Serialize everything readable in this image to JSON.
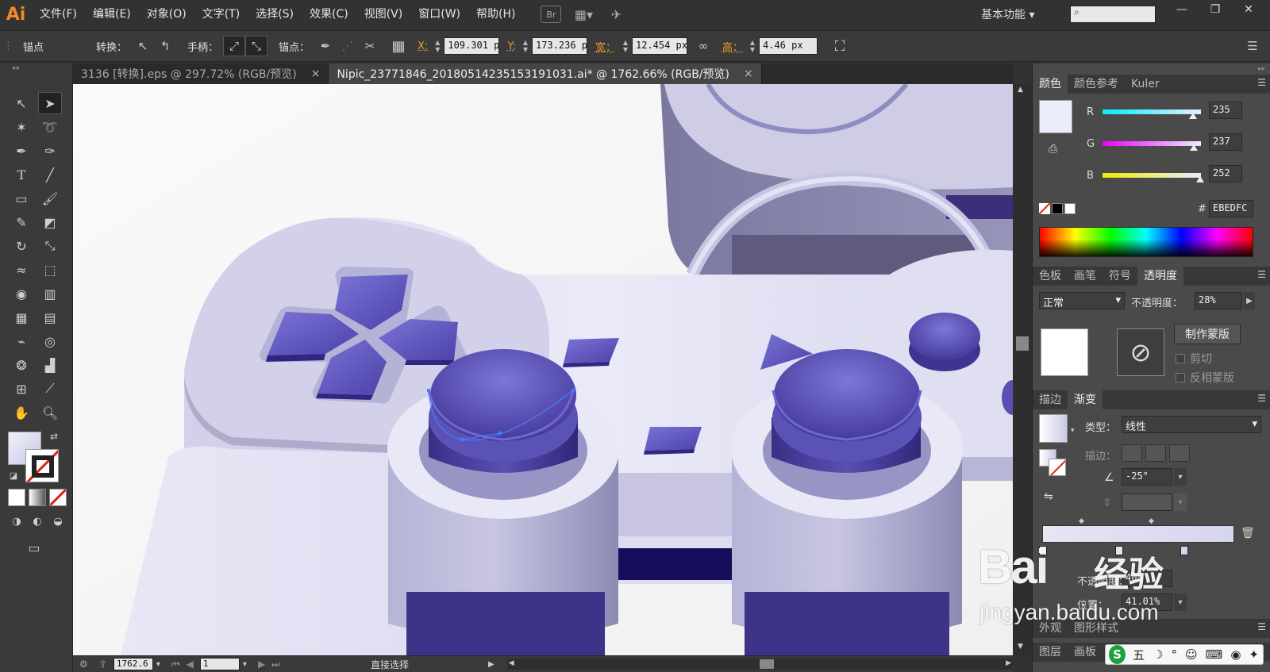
{
  "app": {
    "logo": "Ai",
    "menus": [
      "文件(F)",
      "编辑(E)",
      "对象(O)",
      "文字(T)",
      "选择(S)",
      "效果(C)",
      "视图(V)",
      "窗口(W)",
      "帮助(H)"
    ],
    "bridge": "Br",
    "workspace": "基本功能",
    "workspace_arrow": "▾",
    "search_icon": "⌕",
    "window_controls": [
      "—",
      "❐",
      "✕"
    ]
  },
  "control": {
    "mode": "锚点",
    "convert_label": "转换：",
    "handle_label": "手柄：",
    "anchor_label": "锚点：",
    "x_label": "X:",
    "x_value": "109.301 p",
    "y_label": "Y:",
    "y_value": "173.236 p",
    "w_label": "宽：",
    "w_value": "12.454 px",
    "h_label": "高：",
    "h_value": "4.46 px"
  },
  "tabs": [
    {
      "title": "3136 [转换].eps @ 297.72% (RGB/预览)",
      "close": "×"
    },
    {
      "title": "Nipic_23771846_20180514235153191031.ai* @ 1762.66% (RGB/预览)",
      "close": "×"
    }
  ],
  "status": {
    "zoom": "1762.6",
    "page": "1",
    "tool": "直接选择"
  },
  "color_panel": {
    "tabs": [
      "颜色",
      "颜色参考",
      "Kuler"
    ],
    "r_label": "R",
    "r_value": "235",
    "g_label": "G",
    "g_value": "237",
    "b_label": "B",
    "b_value": "252",
    "r": 235,
    "g": 237,
    "b": 252,
    "hash_label": "#",
    "hex": "EBEDFC",
    "fill_color": "#ebedfc"
  },
  "transparency_panel": {
    "tabs": [
      "色板",
      "画笔",
      "符号",
      "透明度"
    ],
    "blend_mode": "正常",
    "opacity_label": "不透明度：",
    "opacity": "28%",
    "make_mask": "制作蒙版",
    "clip": "剪切",
    "invert_mask": "反相蒙版"
  },
  "gradient_panel": {
    "tabs": [
      "描边",
      "渐变"
    ],
    "type_label": "类型：",
    "type_value": "线性",
    "stroke_label": "描边：",
    "angle": "-25°",
    "location_label": "位置：",
    "location": "41.01%",
    "opacity_label": "不透明度：",
    "opacity": "40%"
  },
  "bottom_panels": {
    "row1": [
      "外观",
      "图形样式"
    ],
    "row2": [
      "图层",
      "画板"
    ]
  },
  "watermark": {
    "brand": "Bai",
    "brand2": "经验",
    "url": "jingyan.baidu.com"
  },
  "ime": {
    "logo": "S",
    "chars": [
      "五",
      "☽",
      "°",
      "☺",
      "⌨",
      "◉",
      "✦"
    ]
  }
}
